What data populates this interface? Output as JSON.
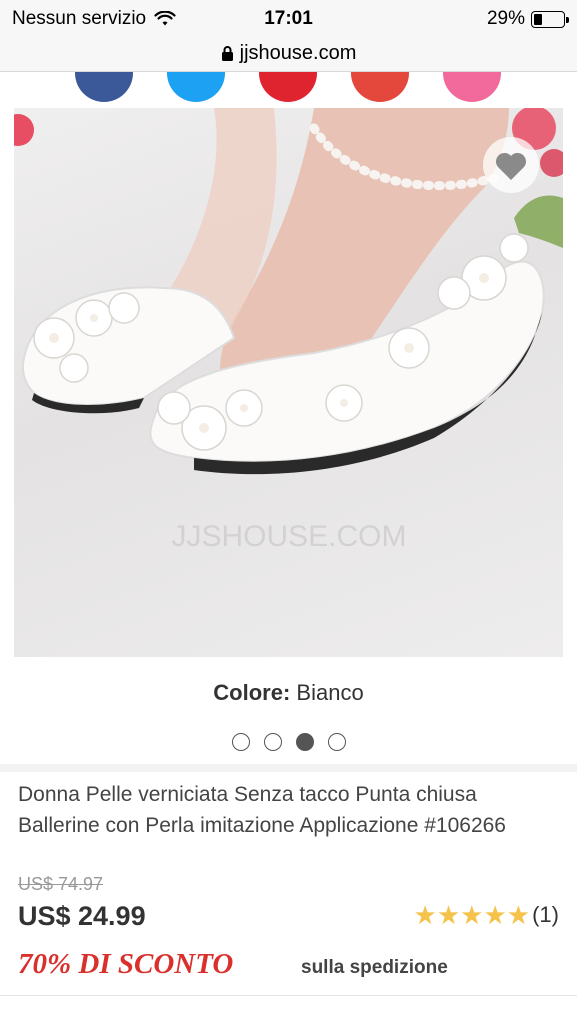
{
  "status_bar": {
    "carrier": "Nessun servizio",
    "time": "17:01",
    "battery_percent": "29%",
    "battery_level": 0.29,
    "wifi_icon": "wifi-icon"
  },
  "url_bar": {
    "url": "jjshouse.com",
    "lock_icon": "lock-icon"
  },
  "share": {
    "icons": [
      "facebook-icon",
      "twitter-icon",
      "pinterest-icon",
      "google-plus-icon",
      "email-icon"
    ],
    "colors": [
      "#3b5998",
      "#1da1f2",
      "#e0242f",
      "#e4473c",
      "#f26a9b"
    ]
  },
  "product": {
    "color_label": "Colore:",
    "color_value": "Bianco",
    "image_count": 4,
    "active_image": 3,
    "title": "Donna Pelle verniciata Senza tacco Punta chiusa Ballerine con Perla imitazione Applicazione #106266",
    "old_price": "US$ 74.97",
    "price": "US$ 24.99",
    "rating": 5,
    "review_count": "(1)",
    "watermark": "JJSHOUSE.COM"
  },
  "promo": {
    "discount": "70% DI SCONTO",
    "shipping": "sulla spedizione",
    "accent_color": "#d9302c"
  }
}
